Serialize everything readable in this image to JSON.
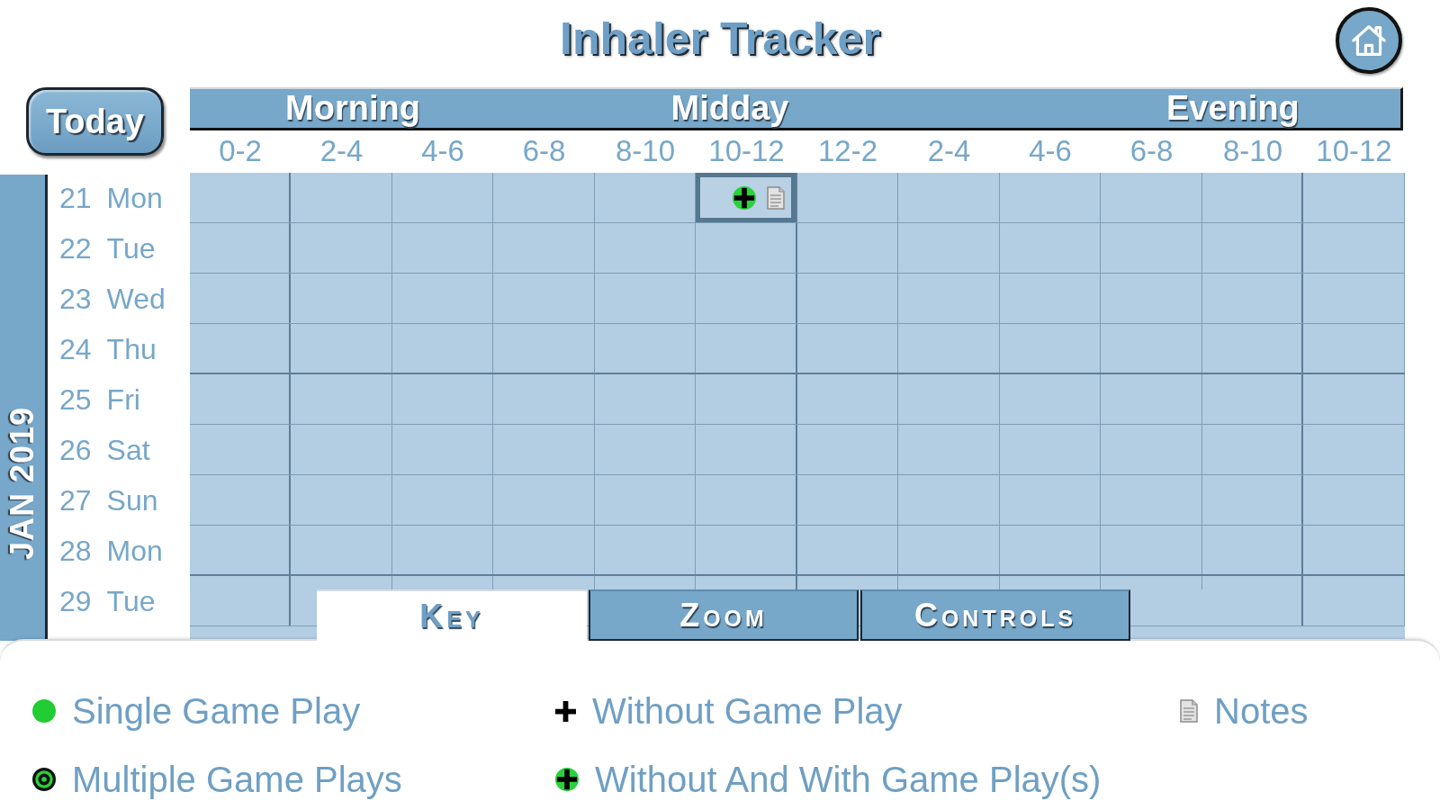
{
  "title": "Inhaler Tracker",
  "today_button": "Today",
  "periods": [
    "Morning",
    "Midday",
    "Evening"
  ],
  "time_slots": [
    "0-2",
    "2-4",
    "4-6",
    "6-8",
    "8-10",
    "10-12",
    "12-2",
    "2-4",
    "4-6",
    "6-8",
    "8-10",
    "10-12"
  ],
  "month": "JAN 2019",
  "days": [
    {
      "date": "21",
      "weekday": "Mon",
      "cells": [
        {
          "selected": false
        },
        {
          "selected": false
        },
        {
          "selected": false
        },
        {
          "selected": false
        },
        {
          "selected": false
        },
        {
          "selected": true,
          "marks": [
            {
              "kind": "without_and_with"
            },
            {
              "kind": "notes"
            }
          ]
        },
        {
          "selected": false
        },
        {
          "selected": false
        },
        {
          "selected": false
        },
        {
          "selected": false
        },
        {
          "selected": false
        },
        {
          "selected": false
        }
      ]
    },
    {
      "date": "22",
      "weekday": "Tue",
      "cells": [
        {
          "selected": false
        },
        {
          "selected": false
        },
        {
          "selected": false
        },
        {
          "selected": false
        },
        {
          "selected": false
        },
        {
          "selected": false
        },
        {
          "selected": false
        },
        {
          "selected": false
        },
        {
          "selected": false
        },
        {
          "selected": false
        },
        {
          "selected": false
        },
        {
          "selected": false
        }
      ]
    },
    {
      "date": "23",
      "weekday": "Wed",
      "cells": [
        {
          "selected": false
        },
        {
          "selected": false
        },
        {
          "selected": false
        },
        {
          "selected": false
        },
        {
          "selected": false
        },
        {
          "selected": false
        },
        {
          "selected": false
        },
        {
          "selected": false
        },
        {
          "selected": false
        },
        {
          "selected": false
        },
        {
          "selected": false
        },
        {
          "selected": false
        }
      ]
    },
    {
      "date": "24",
      "weekday": "Thu",
      "cells": [
        {
          "selected": false
        },
        {
          "selected": false
        },
        {
          "selected": false
        },
        {
          "selected": false
        },
        {
          "selected": false
        },
        {
          "selected": false
        },
        {
          "selected": false
        },
        {
          "selected": false
        },
        {
          "selected": false
        },
        {
          "selected": false
        },
        {
          "selected": false
        },
        {
          "selected": false
        }
      ]
    },
    {
      "date": "25",
      "weekday": "Fri",
      "cells": [
        {
          "selected": false
        },
        {
          "selected": false
        },
        {
          "selected": false
        },
        {
          "selected": false
        },
        {
          "selected": false
        },
        {
          "selected": false
        },
        {
          "selected": false
        },
        {
          "selected": false
        },
        {
          "selected": false
        },
        {
          "selected": false
        },
        {
          "selected": false
        },
        {
          "selected": false
        }
      ]
    },
    {
      "date": "26",
      "weekday": "Sat",
      "cells": [
        {
          "selected": false
        },
        {
          "selected": false
        },
        {
          "selected": false
        },
        {
          "selected": false
        },
        {
          "selected": false
        },
        {
          "selected": false
        },
        {
          "selected": false
        },
        {
          "selected": false
        },
        {
          "selected": false
        },
        {
          "selected": false
        },
        {
          "selected": false
        },
        {
          "selected": false
        }
      ]
    },
    {
      "date": "27",
      "weekday": "Sun",
      "cells": [
        {
          "selected": false
        },
        {
          "selected": false
        },
        {
          "selected": false
        },
        {
          "selected": false
        },
        {
          "selected": false
        },
        {
          "selected": false
        },
        {
          "selected": false
        },
        {
          "selected": false
        },
        {
          "selected": false
        },
        {
          "selected": false
        },
        {
          "selected": false
        },
        {
          "selected": false
        }
      ]
    },
    {
      "date": "28",
      "weekday": "Mon",
      "cells": [
        {
          "selected": false
        },
        {
          "selected": false
        },
        {
          "selected": false
        },
        {
          "selected": false
        },
        {
          "selected": false
        },
        {
          "selected": false
        },
        {
          "selected": false
        },
        {
          "selected": false
        },
        {
          "selected": false
        },
        {
          "selected": false
        },
        {
          "selected": false
        },
        {
          "selected": false
        }
      ]
    },
    {
      "date": "29",
      "weekday": "Tue",
      "cells": [
        {
          "selected": false
        },
        {
          "selected": false
        },
        {
          "selected": false
        },
        {
          "selected": false
        },
        {
          "selected": false
        },
        {
          "selected": false
        },
        {
          "selected": false
        },
        {
          "selected": false
        },
        {
          "selected": false
        },
        {
          "selected": false
        },
        {
          "selected": false
        },
        {
          "selected": false
        }
      ]
    }
  ],
  "tabs": [
    {
      "label": "Key",
      "selected": true
    },
    {
      "label": "Zoom",
      "selected": false
    },
    {
      "label": "Controls",
      "selected": false
    }
  ],
  "legend": [
    {
      "kind": "single",
      "label": "Single Game Play"
    },
    {
      "kind": "without",
      "label": "Without Game Play"
    },
    {
      "kind": "notes",
      "label": "Notes"
    },
    {
      "kind": "multiple",
      "label": "Multiple Game Plays"
    },
    {
      "kind": "without_and_with",
      "label": "Without And With Game Play(s)"
    }
  ]
}
